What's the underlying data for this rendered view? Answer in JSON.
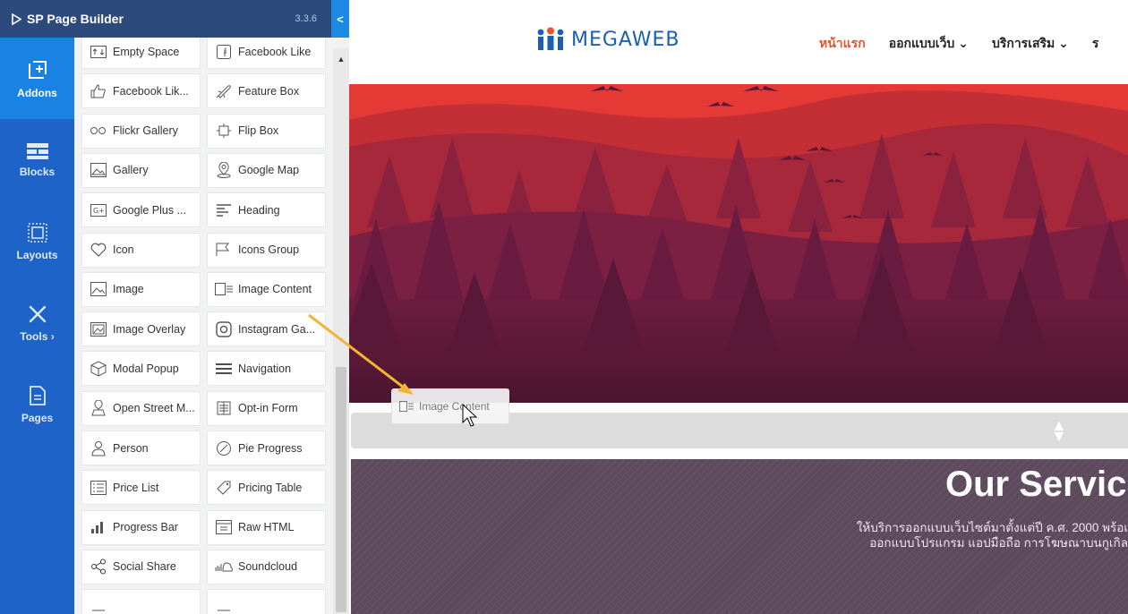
{
  "builder": {
    "title": "SP Page Builder",
    "version": "3.3.6",
    "collapse_glyph": "<"
  },
  "left_nav": [
    {
      "label": "Addons",
      "icon": "add-square-icon",
      "active": true
    },
    {
      "label": "Blocks",
      "icon": "blocks-icon",
      "active": false
    },
    {
      "label": "Layouts",
      "icon": "layouts-icon",
      "active": false
    },
    {
      "label": "Tools ›",
      "icon": "tools-icon",
      "active": false
    },
    {
      "label": "Pages",
      "icon": "pages-icon",
      "active": false
    }
  ],
  "addons": [
    {
      "label": "Empty Space",
      "icon": "empty-space-icon"
    },
    {
      "label": "Facebook Like",
      "icon": "facebook-icon"
    },
    {
      "label": "Facebook Lik...",
      "icon": "thumbs-up-icon"
    },
    {
      "label": "Feature Box",
      "icon": "rocket-icon"
    },
    {
      "label": "Flickr Gallery",
      "icon": "flickr-icon"
    },
    {
      "label": "Flip Box",
      "icon": "flip-box-icon"
    },
    {
      "label": "Gallery",
      "icon": "gallery-icon"
    },
    {
      "label": "Google Map",
      "icon": "map-pin-icon"
    },
    {
      "label": "Google Plus ...",
      "icon": "google-plus-icon"
    },
    {
      "label": "Heading",
      "icon": "heading-icon"
    },
    {
      "label": "Icon",
      "icon": "heart-icon"
    },
    {
      "label": "Icons Group",
      "icon": "icons-group-icon"
    },
    {
      "label": "Image",
      "icon": "image-icon"
    },
    {
      "label": "Image Content",
      "icon": "image-content-icon"
    },
    {
      "label": "Image Overlay",
      "icon": "image-overlay-icon"
    },
    {
      "label": "Instagram Ga...",
      "icon": "instagram-icon"
    },
    {
      "label": "Modal Popup",
      "icon": "modal-popup-icon"
    },
    {
      "label": "Navigation",
      "icon": "menu-icon"
    },
    {
      "label": "Open Street M...",
      "icon": "street-map-icon"
    },
    {
      "label": "Opt-in Form",
      "icon": "opt-in-form-icon"
    },
    {
      "label": "Person",
      "icon": "person-icon"
    },
    {
      "label": "Pie Progress",
      "icon": "pie-progress-icon"
    },
    {
      "label": "Price List",
      "icon": "price-list-icon"
    },
    {
      "label": "Pricing Table",
      "icon": "pricing-tag-icon"
    },
    {
      "label": "Progress Bar",
      "icon": "progress-bar-icon"
    },
    {
      "label": "Raw HTML",
      "icon": "raw-html-icon"
    },
    {
      "label": "Social Share",
      "icon": "share-icon"
    },
    {
      "label": "Soundcloud",
      "icon": "soundcloud-icon"
    },
    {
      "label": "",
      "icon": "partial-icon"
    },
    {
      "label": "",
      "icon": "partial-icon"
    }
  ],
  "site": {
    "logo_text": "MEGAWEB",
    "nav": [
      {
        "label": "หน้าแรก",
        "active": true
      },
      {
        "label": "ออกแบบเว็บ ⌄",
        "active": false
      },
      {
        "label": "บริการเสริม ⌄",
        "active": false
      },
      {
        "label": "ร",
        "active": false
      }
    ]
  },
  "services": {
    "title": "Our Servic",
    "line1": "ให้บริการออกแบบเว็บไซต์มาตั้งแต่ปี ค.ศ. 2000 พร้อเ",
    "line2": "ออกแบบโปรแกรม แอปมือถือ การโฆษณาบนกูเกิล"
  },
  "drag_ghost": {
    "label": "Image Content",
    "icon": "image-content-icon"
  },
  "colors": {
    "builder_header": "#2d4a7c",
    "left_nav": "#1e63c7",
    "nav_active": "#1a82e3",
    "site_nav_active": "#e8542a",
    "hero_sky": "#e53935",
    "services_bg": "#5d4a5d",
    "drag_arrow": "#f2b531"
  }
}
